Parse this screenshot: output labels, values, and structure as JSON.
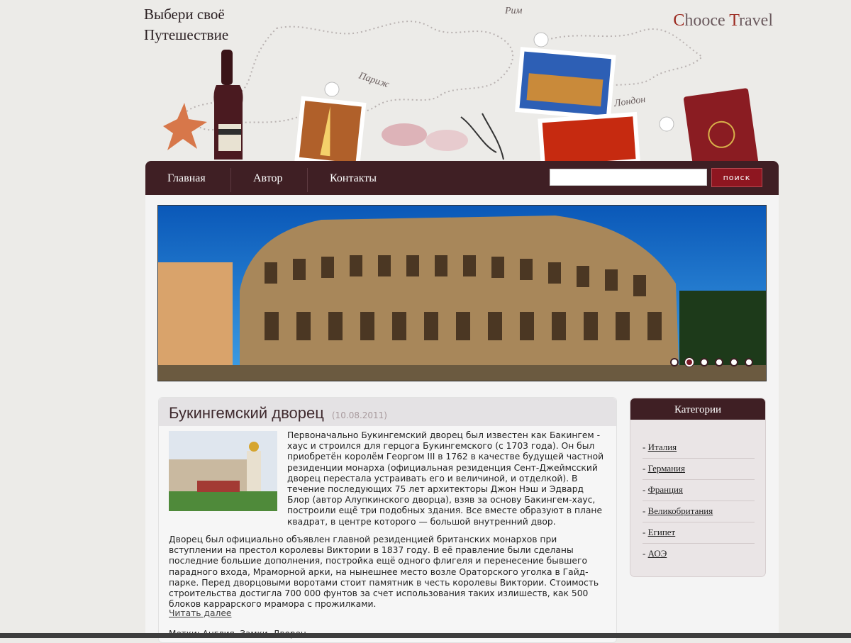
{
  "header": {
    "slogan_line1": "Выбери своё",
    "slogan_line2": "Путешествие",
    "brand_c": "C",
    "brand_mid": "hooce ",
    "brand_t": "T",
    "brand_end": "ravel",
    "city_rome": "Рим",
    "city_paris": "Париж",
    "city_london": "Лондон"
  },
  "nav": {
    "items": [
      "Главная",
      "Автор",
      "Контакты"
    ],
    "search_placeholder": "",
    "search_button": "поиск"
  },
  "slider": {
    "dots_count": 6,
    "active_dot": 2
  },
  "article": {
    "title": "Букингемский дворец",
    "date": "(10.08.2011)",
    "para1": "Первоначально Букингемский дворец был известен как Бакингем - хаус и строился для герцога Букингемского (с 1703 года). Он был приобретён королём Георгом III в 1762 в качестве будущей частной резиденции монарха (официальная резиденция Сент-Джеймсский дворец перестала устраивать его и величиной, и отделкой). В течение последующих 75 лет архитекторы Джон Нэш и Эдвард Блор (автор Алупкинского дворца), взяв за основу Бакингем-хаус, построили ещё три подобных здания. Все вместе образуют в плане квадрат, в центре которого — большой внутренний двор.",
    "para2": "Дворец был официально объявлен главной резиденцией британских монархов при вступлении на престол королевы Виктории в 1837 году. В её правление были сделаны последние большие дополнения, постройка ещё одного флигеля и перенесение бывшего парадного входа, Мраморной арки, на нынешнее место возле Ораторского уголка в Гайд-парке. Перед дворцовыми воротами стоит памятник в честь королевы Виктории. Стоимость строительства достигла 700 000 фунтов за счет использования таких излишеств, как 500 блоков каррарского мрамора с прожилками.",
    "read_more": "Читать далее",
    "tags_label": "Метки:",
    "tags": [
      "Англия",
      "Замки",
      "Дворец"
    ]
  },
  "sidebar": {
    "title": "Категории",
    "categories": [
      "Италия",
      "Германия",
      "Франция",
      "Великобритания",
      "Египет",
      "АОЭ"
    ]
  },
  "colors": {
    "nav_bg": "#3f1f24",
    "search_button": "#8e1620",
    "brand_accent": "#9b2a20",
    "page_bg": "#ecebe8"
  }
}
